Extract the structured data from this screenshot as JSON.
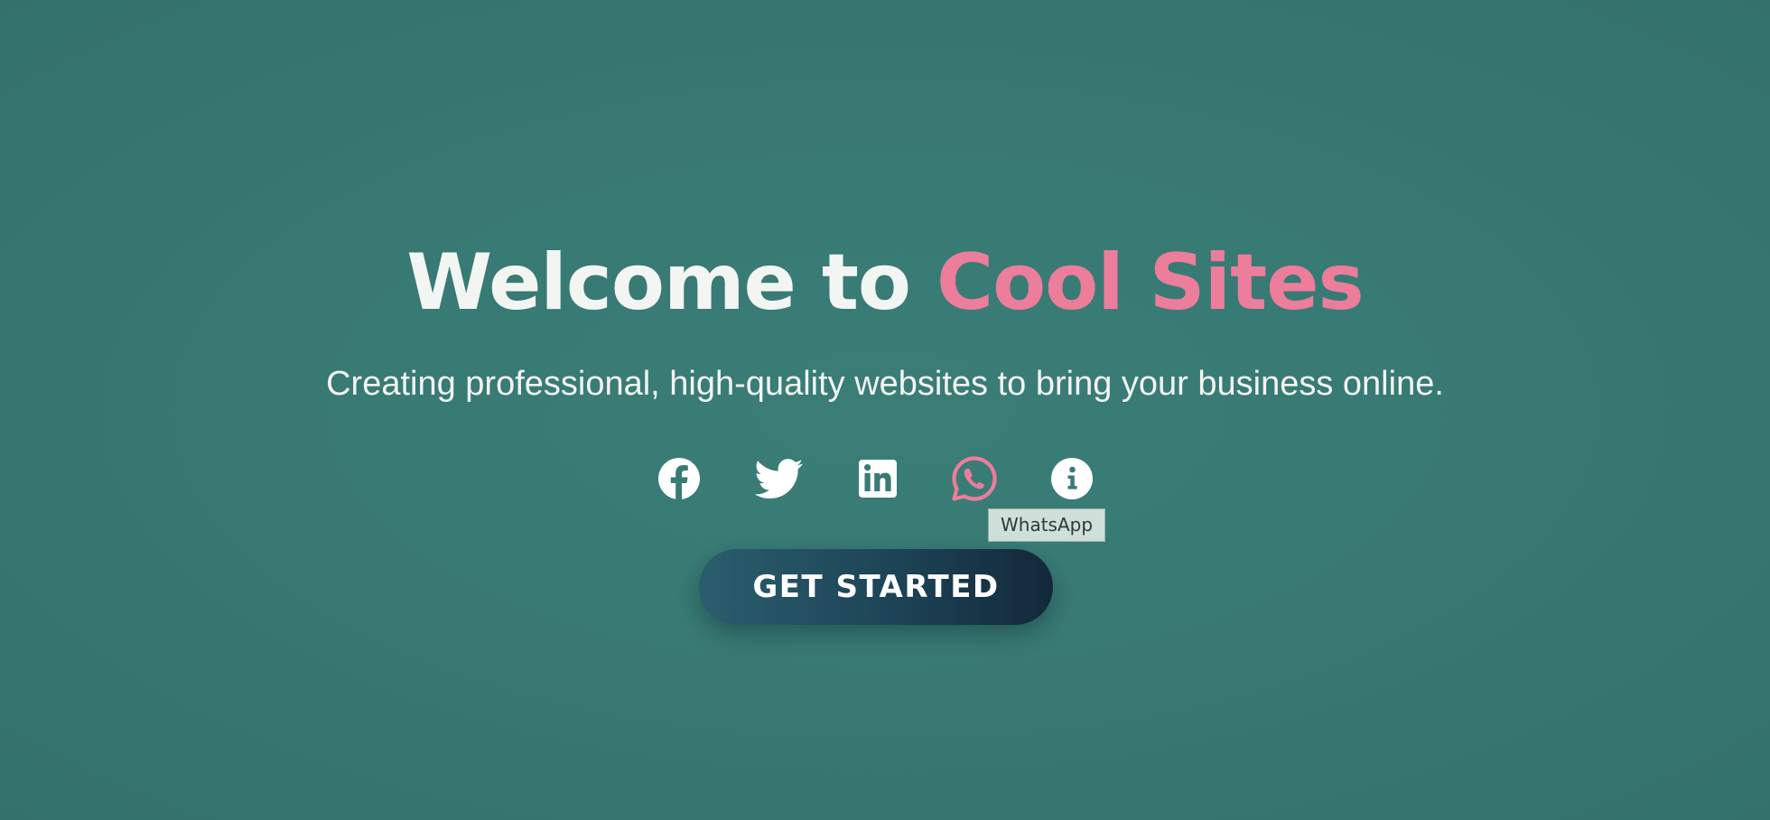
{
  "hero": {
    "title_prefix": "Welcome to ",
    "title_accent": "Cool Sites",
    "subtitle": "Creating professional, high-quality websites to bring your business online.",
    "cta_label": "GET STARTED"
  },
  "social": {
    "items": [
      {
        "name": "Facebook",
        "icon": "facebook-icon"
      },
      {
        "name": "Twitter",
        "icon": "twitter-icon"
      },
      {
        "name": "LinkedIn",
        "icon": "linkedin-icon"
      },
      {
        "name": "WhatsApp",
        "icon": "whatsapp-icon",
        "state": "hovered"
      },
      {
        "name": "Info",
        "icon": "info-icon"
      }
    ],
    "tooltip": "WhatsApp"
  },
  "colors": {
    "background": "#387a74",
    "title": "#f3f5f3",
    "accent": "#ec7d9b",
    "icon": "#ffffff",
    "icon_hover": "#ec7d9b",
    "button_start": "#2b5d6d",
    "button_end": "#12283a"
  }
}
